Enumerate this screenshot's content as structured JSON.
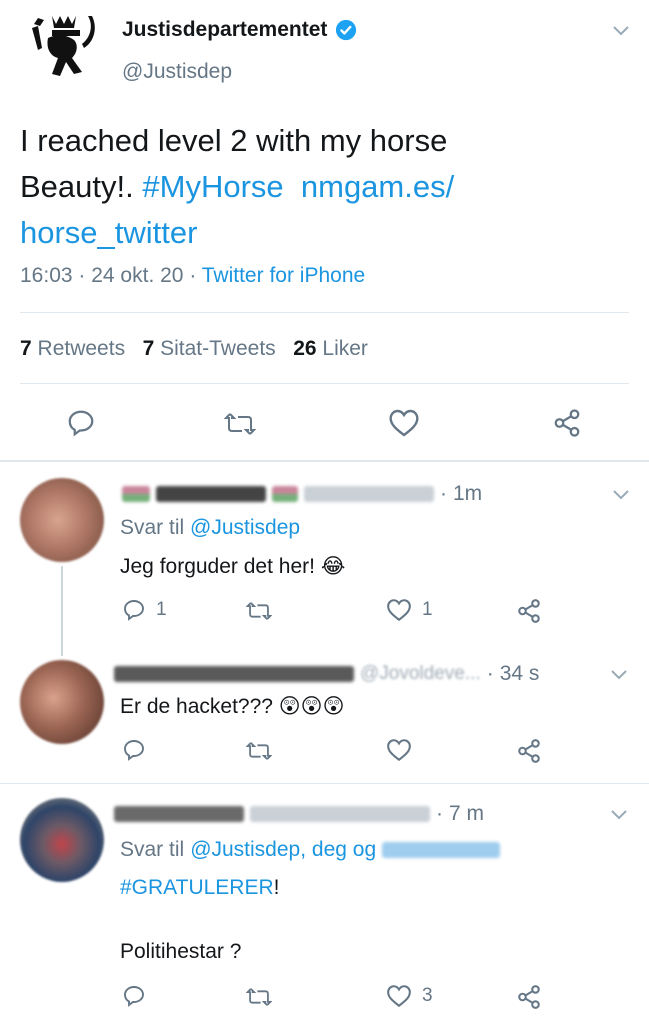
{
  "colors": {
    "accent": "#1b95e0",
    "text": "#14171a",
    "muted": "#657786",
    "divider": "#e1e8ed"
  },
  "main_tweet": {
    "author_name": "Justisdepartementet",
    "handle": "@Justisdep",
    "verified_icon": "verified-badge-icon",
    "text_plain": "I reached level 2 with my horse Beauty!.",
    "hashtag": "#MyHorse",
    "link_part1": "nmgam.es/",
    "link_part2": "horse_twitter",
    "time": "16:03",
    "date": "24 okt. 20",
    "source": "Twitter for iPhone",
    "stats": {
      "retweets_count": "7",
      "retweets_label": "Retweets",
      "quotes_count": "7",
      "quotes_label": "Sitat-Tweets",
      "likes_count": "26",
      "likes_label": "Liker"
    }
  },
  "replies": [
    {
      "time": "1m",
      "reply_to_prefix": "Svar til",
      "reply_to": "@Justisdep",
      "text": "Jeg forguder det her!",
      "emoji": "😂",
      "reply_count": "1",
      "like_count": "1"
    },
    {
      "time": "34 s",
      "handle_fragment": "@Jovoldeve...",
      "text": "Er de hacket???",
      "emoji": "😲😲😲"
    },
    {
      "time": "7 m",
      "reply_to_prefix": "Svar til",
      "reply_to": "@Justisdep, deg og",
      "hashtag": "#GRATULERER",
      "hashtag_suffix": "!",
      "text2": "Politihestar ?",
      "like_count": "3"
    }
  ]
}
